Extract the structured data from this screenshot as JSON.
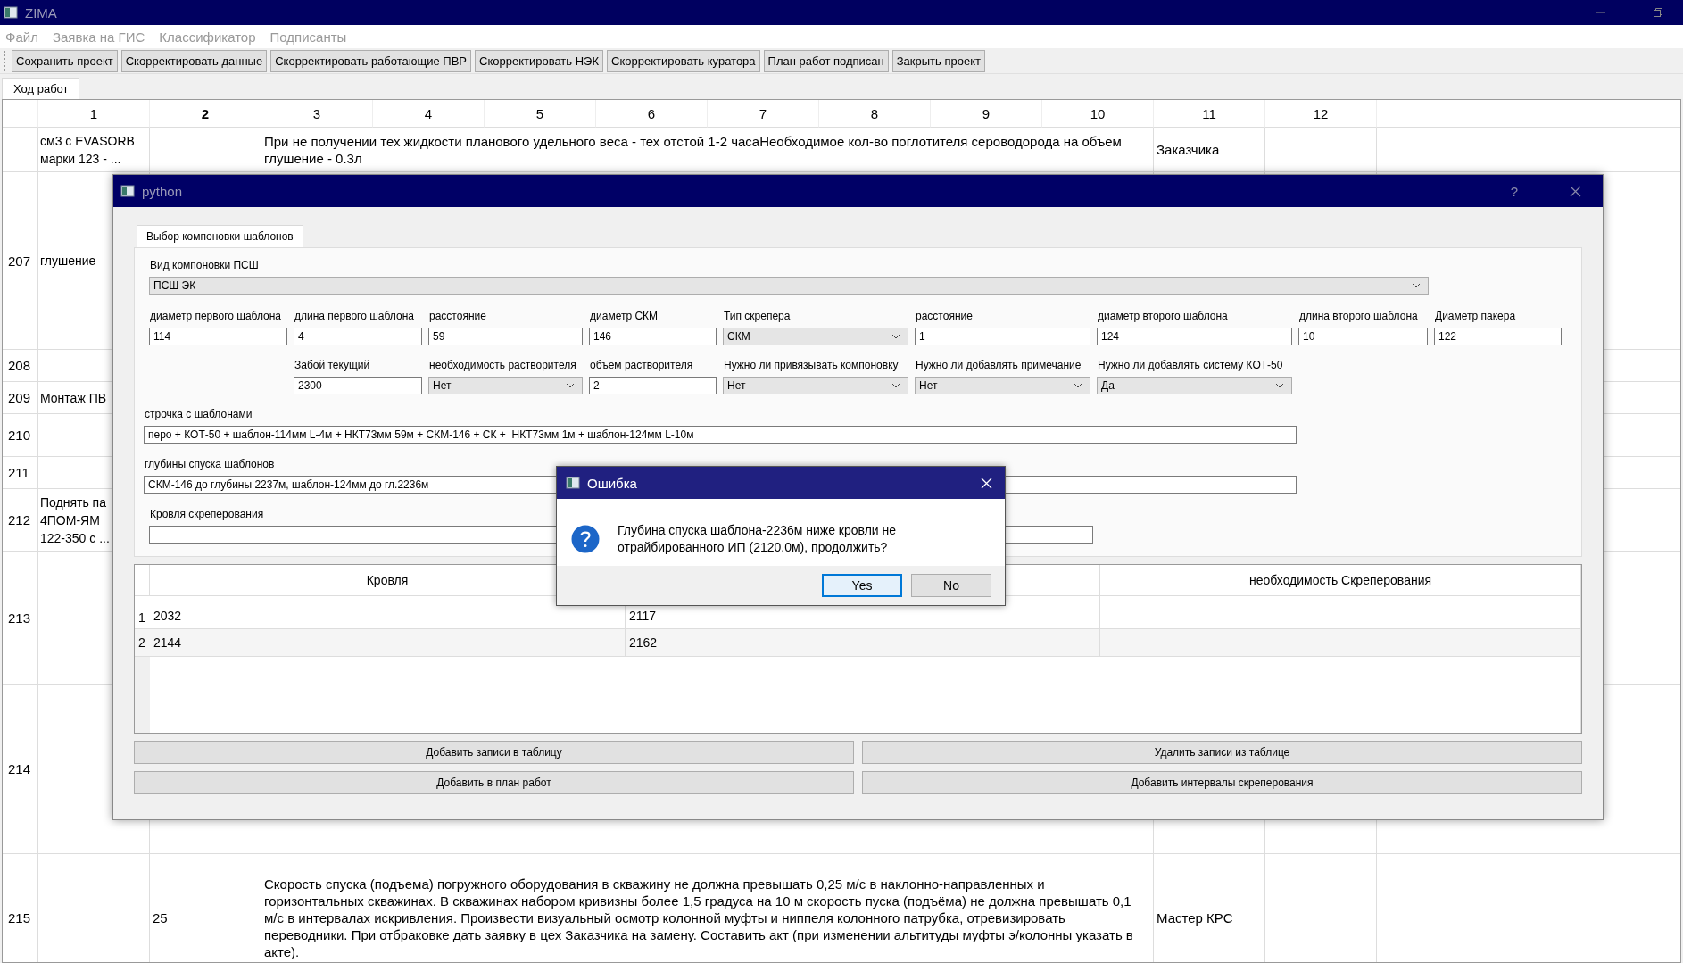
{
  "window": {
    "title": "ZIMA"
  },
  "menu": [
    "Файл",
    "Заявка на ГИС",
    "Классификатор",
    "Подписанты"
  ],
  "toolbar": [
    "Сохранить проект",
    "Скорректировать данные",
    "Скорректировать работающие ПВР",
    "Скорректировать НЭК",
    "Скорректировать куратора",
    "План работ подписан",
    "Закрыть проект"
  ],
  "tabs": [
    {
      "label": "Ход работ",
      "selected": true
    }
  ],
  "table": {
    "columns": [
      {
        "label": "1",
        "selected": false
      },
      {
        "label": "2",
        "selected": true
      },
      {
        "label": "3",
        "selected": false
      },
      {
        "label": "4",
        "selected": false
      },
      {
        "label": "5",
        "selected": false
      },
      {
        "label": "6",
        "selected": false
      },
      {
        "label": "7",
        "selected": false
      },
      {
        "label": "8",
        "selected": false
      },
      {
        "label": "9",
        "selected": false
      },
      {
        "label": "10",
        "selected": false
      },
      {
        "label": "11",
        "selected": false
      },
      {
        "label": "12",
        "selected": false
      }
    ],
    "rows": [
      {
        "cells": {
          "1": "см3 с EVASORB\nмарки 123 - ...",
          "3": "При не получении тех жидкости планового удельного веса - тех отстой 1-2 часаНеобходимое кол-во поглотителя сероводорода на объем\nглушение - 0.3л",
          "11": "Заказчика"
        }
      },
      {
        "number": "207",
        "cells": {
          "1": "глушение"
        }
      },
      {
        "number": "208",
        "cells": {}
      },
      {
        "number": "209",
        "cells": {
          "1": "Монтаж ПВ"
        }
      },
      {
        "number": "210",
        "cells": {}
      },
      {
        "number": "211",
        "cells": {}
      },
      {
        "number": "212",
        "cells": {
          "1": "Поднять па\n4ПОМ-ЯМ\n122-350 с ..."
        }
      },
      {
        "number": "213",
        "cells": {}
      },
      {
        "number": "214",
        "cells": {}
      },
      {
        "number": "215",
        "cells": {
          "2": "25",
          "3": "Скорость спуска (подъема) погружного оборудования в скважину не должна превышать 0,25 м/с в наклонно-направленных и\nгоризонтальных скважинах. В скважинах набором кривизны более 1,5 градуса на 10 м скорость пуска (подъёма) не должна превышать 0,1\nм/с в интервалах искривления. Произвести визуальный осмотр колонной муфты и ниппеля колонного патрубка, отревизировать\nпереводники. При отбраковке дать заявку в цех Заказчика на замену. Составить акт (при изменении альтитуды муфты э/колонны указать в\nакте).",
          "11": "Мастер КРС"
        }
      }
    ]
  },
  "dialog": {
    "title": "python",
    "help": "?",
    "tabs": [
      {
        "label": "Выбор компоновки шаблонов",
        "selected": true
      }
    ],
    "layout_type": {
      "label": "Вид компоновки ПСШ",
      "value": "ПСШ ЭК"
    },
    "field_rows": [
      [
        {
          "kind": "text",
          "label": "диаметр первого шаблона",
          "value": "114"
        },
        {
          "kind": "text",
          "label": "длина первого шаблона",
          "value": "4"
        },
        {
          "kind": "text",
          "label": "расстояние",
          "value": "59"
        },
        {
          "kind": "text",
          "label": "диаметр СКМ",
          "value": "146"
        },
        {
          "kind": "combo",
          "label": "Тип скрепера",
          "value": "СКМ"
        },
        {
          "kind": "text",
          "label": "расстояние",
          "value": "1"
        },
        {
          "kind": "text",
          "label": "диаметр второго шаблона",
          "value": "124"
        },
        {
          "kind": "text",
          "label": "длина второго шаблона",
          "value": "10"
        },
        {
          "kind": "text",
          "label": "Диаметр пакера",
          "value": "122"
        }
      ],
      [
        {
          "kind": "text",
          "label": "Забой текущий",
          "value": "2300"
        },
        {
          "kind": "combo",
          "label": "необходимость растворителя",
          "value": "Нет"
        },
        {
          "kind": "text",
          "label": "объем растворителя",
          "value": "2"
        },
        {
          "kind": "combo",
          "label": "Нужно ли привязывать компоновку",
          "value": "Нет"
        },
        {
          "kind": "combo",
          "label": "Нужно ли добавлять примечание",
          "value": "Нет"
        },
        {
          "kind": "combo",
          "label": "Нужно ли добавлять систему КОТ-50",
          "value": "Да"
        }
      ]
    ],
    "template_string": {
      "label": "строчка с шаблонами",
      "value": "перо + КОТ-50 + шаблон-114мм L-4м + НКТ73мм 59м + СКМ-146 + СК +  НКТ73мм 1м + шаблон-124мм L-10м"
    },
    "depths": {
      "label": "глубины спуска шаблонов",
      "value": "СКМ-146 до глубины 2237м, шаблон-124мм до гл.2236м"
    },
    "scraping_top": {
      "label": "Кровля скреперования"
    },
    "table": {
      "columns": [
        {
          "label": "Кровля"
        },
        {},
        {
          "label": "необходимость Скреперования"
        }
      ],
      "rows": [
        {
          "number": "1",
          "cells": [
            "2032",
            "2117"
          ]
        },
        {
          "number": "2",
          "cells": [
            "2144",
            "2162"
          ]
        }
      ]
    },
    "buttons": [
      "Добавить записи в таблицу",
      "Удалить записи из таблице",
      "Добавить в план работ",
      "Добавить интервалы скреперования"
    ]
  },
  "error": {
    "title": "Ошибка",
    "message": "Глубина спуска шаблона-2236м ниже кровли не отрайбированного ИП (2120.0м), продолжить?",
    "buttons": [
      {
        "label": "Yes",
        "default": true
      },
      {
        "label": "No",
        "default": false
      }
    ]
  }
}
